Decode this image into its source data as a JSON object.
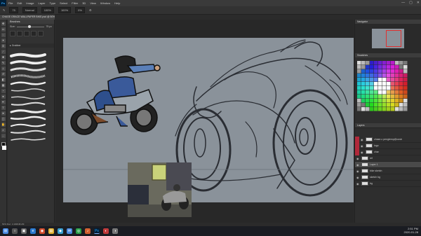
{
  "app": {
    "logo": "Ps",
    "menu": [
      "File",
      "Edit",
      "Image",
      "Layer",
      "Type",
      "Select",
      "Filter",
      "3D",
      "View",
      "Window",
      "Help"
    ],
    "window_controls": [
      "—",
      "▢",
      "✕"
    ]
  },
  "options": {
    "brush_size": "75",
    "mode_label": "Normal",
    "opacity": "100%",
    "flow": "100%",
    "smoothing": "0%"
  },
  "document": {
    "tab_title": "CHASE GRACE WALLPAPER BIKE.psd @ 50% (Layer 1, RGB/8)"
  },
  "brushes": {
    "panel_title": "Brushes",
    "size_label": "Size:",
    "size_value": "75 px",
    "group_label": "▸ Grabber"
  },
  "right": {
    "navigator_tabs": "Navigator",
    "swatches_tabs": "Swatches",
    "layers_tabs": "Layers",
    "layers": [
      {
        "name": "chase-c pengtemp@oosb",
        "selected": false,
        "flag": true
      },
      {
        "name": "logo",
        "selected": false,
        "flag": true
      },
      {
        "name": "char",
        "selected": false,
        "flag": true
      },
      {
        "name": "ref",
        "selected": false,
        "flag": false
      },
      {
        "name": "Layer 1",
        "selected": true,
        "flag": false
      },
      {
        "name": "bike sketch",
        "selected": false,
        "flag": false
      },
      {
        "name": "sketch bg",
        "selected": false,
        "flag": false
      },
      {
        "name": "bg",
        "selected": false,
        "flag": false
      }
    ]
  },
  "status": {
    "text": "50%      Doc: 3.10M/48.2M"
  },
  "taskbar": {
    "icons": [
      "⊞",
      "○",
      "▣",
      "e",
      "◉",
      "▤",
      "◆",
      "✉",
      "◎",
      "♪",
      "Ps",
      "◐",
      "◑"
    ],
    "time": "2:51 PM",
    "date": "2020-01-28"
  },
  "colors": {
    "canvas": "#8a929a",
    "accent": "#b0283a"
  }
}
